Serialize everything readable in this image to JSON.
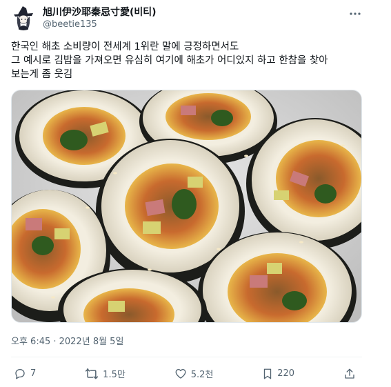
{
  "author": {
    "display_name": "旭川伊沙耶秦忌寸愛(비티)",
    "handle": "@beetie135"
  },
  "tweet": {
    "lines": [
      "한국인 해초 소비량이 전세계 1위란 말에 긍정하면서도",
      "그 예시로 김밥을 가져오면 유심히 여기에 해초가 어디있지 하고 한참을 찾아",
      "보는게 좀 웃김"
    ],
    "timestamp": "오후 6:45 · 2022년 8월 5일"
  },
  "actions": {
    "replies": "7",
    "retweets": "1.5만",
    "likes": "5.2천",
    "bookmarks": "220"
  },
  "icons": {
    "more": "more-icon",
    "reply": "reply-icon",
    "retweet": "retweet-icon",
    "like": "heart-icon",
    "bookmark": "bookmark-icon",
    "share": "share-icon"
  },
  "colors": {
    "text": "#0f1419",
    "secondary": "#536471",
    "divider": "#eff3f4"
  }
}
